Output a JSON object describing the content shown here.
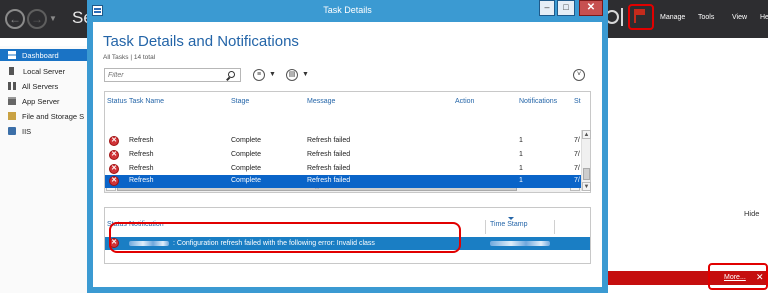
{
  "background": {
    "app_title": "Se",
    "menu": [
      "Manage",
      "Tools",
      "View",
      "He"
    ],
    "sidebar": [
      {
        "label": "Dashboard",
        "icon": "dashboard-icon",
        "active": true
      },
      {
        "label": "Local Server",
        "icon": "server-icon",
        "active": false
      },
      {
        "label": "All Servers",
        "icon": "servers-icon",
        "active": false
      },
      {
        "label": "App Server",
        "icon": "app-server-icon",
        "active": false
      },
      {
        "label": "File and Storage S",
        "icon": "file-storage-icon",
        "active": false
      },
      {
        "label": "IIS",
        "icon": "iis-icon",
        "active": false
      }
    ],
    "hide_label": "Hide",
    "more_link": "More...",
    "status_bar_color": "#c50e0e",
    "accent_color": "#1a73c5"
  },
  "dialog": {
    "window_title": "Task Details",
    "heading": "Task Details and Notifications",
    "count_text": "All Tasks | 14 total",
    "filter_placeholder": "Filter",
    "close_glyph": "✕",
    "tasks": {
      "columns": [
        "Status",
        "Task Name",
        "Stage",
        "Message",
        "Action",
        "Notifications",
        "St"
      ],
      "rows": [
        {
          "status": "error-icon",
          "task": "Refresh",
          "stage": "Complete",
          "message": "Refresh failed",
          "action": "",
          "notifications": "1",
          "st": "7/",
          "selected": false
        },
        {
          "status": "error-icon",
          "task": "Refresh",
          "stage": "Complete",
          "message": "Refresh failed",
          "action": "",
          "notifications": "1",
          "st": "7/",
          "selected": false
        },
        {
          "status": "error-icon",
          "task": "Refresh",
          "stage": "Complete",
          "message": "Refresh failed",
          "action": "",
          "notifications": "1",
          "st": "7/",
          "selected": false
        },
        {
          "status": "error-icon",
          "task": "Refresh",
          "stage": "Complete",
          "message": "Refresh failed",
          "action": "",
          "notifications": "1",
          "st": "7/",
          "selected": true
        }
      ]
    },
    "notifications": {
      "columns": [
        "Status",
        "Notification",
        "Time Stamp"
      ],
      "rows": [
        {
          "status": "error-icon",
          "notification": ": Configuration refresh failed with the following error: Invalid class",
          "timestamp": ""
        }
      ]
    },
    "highlight_color": "#e10000"
  }
}
